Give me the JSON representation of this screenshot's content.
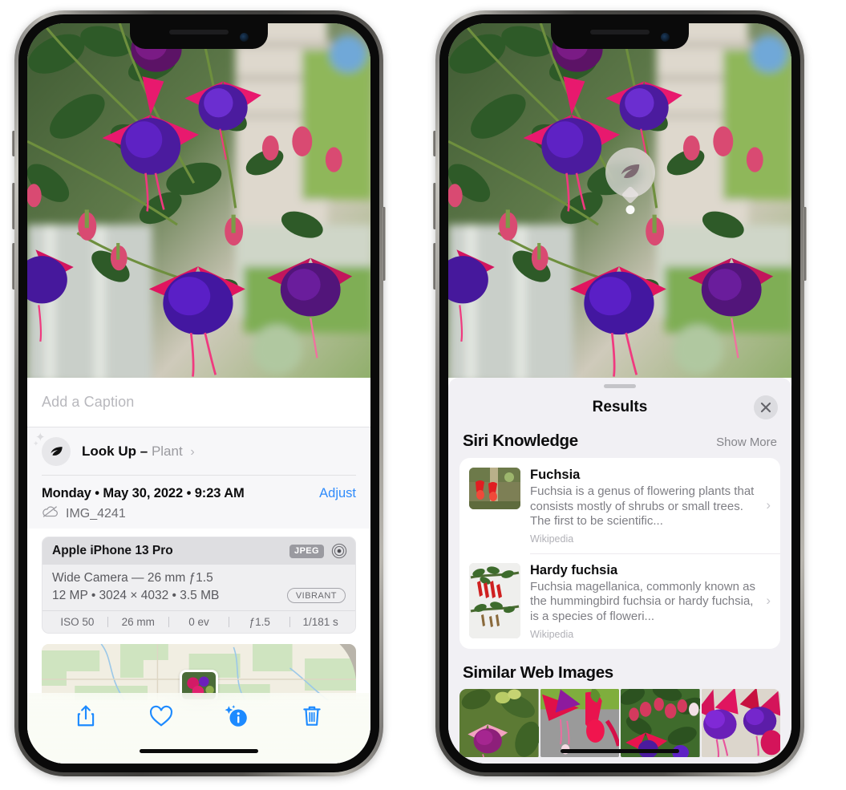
{
  "left_phone": {
    "caption": {
      "placeholder": "Add a Caption",
      "value": ""
    },
    "lookup": {
      "label": "Look Up",
      "dash": "–",
      "subject": "Plant",
      "chevron": "›",
      "icon": "leaf-icon"
    },
    "meta": {
      "date_line": "Monday • May 30, 2022 • 9:23 AM",
      "adjust_label": "Adjust",
      "filename": "IMG_4241",
      "cloud_icon": "icloud-slash-icon"
    },
    "exif": {
      "device": "Apple iPhone 13 Pro",
      "format_badge": "JPEG",
      "lens_icon": "aperture-icon",
      "lens_line": "Wide Camera — 26 mm ƒ1.5",
      "specs_line": "12 MP • 3024 × 4032 • 3.5 MB",
      "style_badge": "VIBRANT",
      "stats": [
        "ISO 50",
        "26 mm",
        "0 ev",
        "ƒ1.5",
        "1/181 s"
      ]
    },
    "toolbar": [
      {
        "name": "share-button",
        "icon": "share-icon"
      },
      {
        "name": "favorite-button",
        "icon": "heart-icon"
      },
      {
        "name": "info-button",
        "icon": "info-sparkle-icon"
      },
      {
        "name": "delete-button",
        "icon": "trash-icon"
      }
    ]
  },
  "right_phone": {
    "visual_lookup_badge": {
      "icon": "leaf-icon"
    },
    "sheet": {
      "title": "Results",
      "close_icon": "close-icon"
    },
    "siri_knowledge": {
      "section_title": "Siri Knowledge",
      "show_more": "Show More",
      "items": [
        {
          "title": "Fuchsia",
          "description": "Fuchsia is a genus of flowering plants that consists mostly of shrubs or small trees. The first to be scientific...",
          "source": "Wikipedia",
          "chevron": "›"
        },
        {
          "title": "Hardy fuchsia",
          "description": "Fuchsia magellanica, commonly known as the hummingbird fuchsia or hardy fuchsia, is a species of floweri...",
          "source": "Wikipedia",
          "chevron": "›"
        }
      ]
    },
    "similar_web_images": {
      "section_title": "Similar Web Images",
      "thumbnails": [
        "thumb-1",
        "thumb-2",
        "thumb-3",
        "thumb-4"
      ]
    }
  },
  "colors": {
    "accent_blue": "#2f8bfb",
    "sheet_background": "#f1f0f4",
    "card_background": "#ffffff",
    "exif_header": "#dedee1",
    "secondary_text": "#7e7e84"
  }
}
